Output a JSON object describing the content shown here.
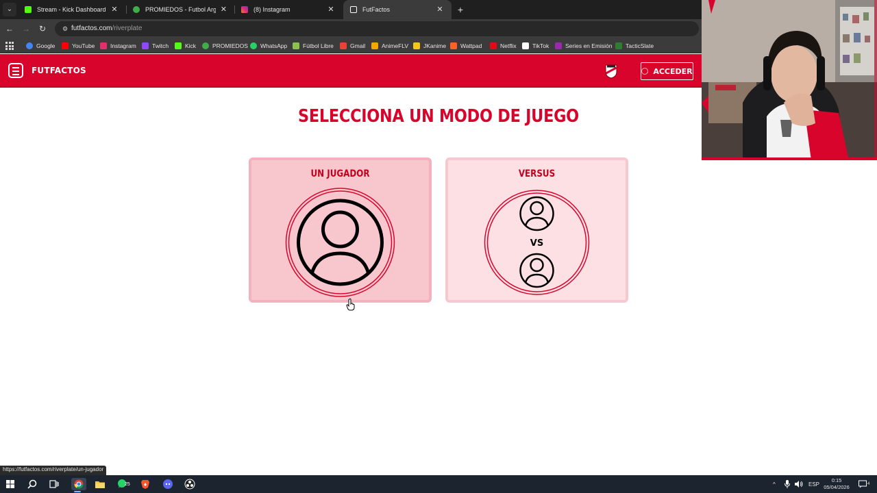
{
  "browser": {
    "tabs": [
      {
        "title": "Stream - Kick Dashboard",
        "icon": "kick-icon",
        "color": "#53fc18",
        "active": false
      },
      {
        "title": "PROMIEDOS - Futbol Argentino",
        "icon": "promiedos-icon",
        "color": "#3fae49",
        "active": false
      },
      {
        "title": "(8) Instagram",
        "icon": "instagram-icon",
        "color": "#e1306c",
        "active": false
      },
      {
        "title": "FutFactos",
        "icon": "futfactos-icon",
        "color": "#ffffff",
        "active": true
      }
    ],
    "close_glyph": "✕",
    "new_tab_glyph": "+",
    "url_host": "futfactos.com",
    "url_path": "/riverplate",
    "bookmarks": [
      {
        "label": "Google",
        "icon": "google-icon",
        "color": "#4285f4"
      },
      {
        "label": "YouTube",
        "icon": "youtube-icon",
        "color": "#ff0000"
      },
      {
        "label": "Instagram",
        "icon": "instagram-icon",
        "color": "#e1306c"
      },
      {
        "label": "Twitch",
        "icon": "twitch-icon",
        "color": "#9146ff"
      },
      {
        "label": "Kick",
        "icon": "kick-icon",
        "color": "#53fc18"
      },
      {
        "label": "PROMIEDOS",
        "icon": "promiedos-icon",
        "color": "#3fae49"
      },
      {
        "label": "WhatsApp",
        "icon": "whatsapp-icon",
        "color": "#25d366"
      },
      {
        "label": "Fútbol Libre",
        "icon": "futbol-libre-icon",
        "color": "#8bc34a"
      },
      {
        "label": "Gmail",
        "icon": "gmail-icon",
        "color": "#ea4335"
      },
      {
        "label": "AnimeFLV",
        "icon": "animeflv-icon",
        "color": "#f7a600"
      },
      {
        "label": "JKanime",
        "icon": "jkanime-icon",
        "color": "#f5c518"
      },
      {
        "label": "Wattpad",
        "icon": "wattpad-icon",
        "color": "#ff6122"
      },
      {
        "label": "Netflix",
        "icon": "netflix-icon",
        "color": "#e50914"
      },
      {
        "label": "TikTok",
        "icon": "tiktok-icon",
        "color": "#ffffff"
      },
      {
        "label": "Series en Emisión",
        "icon": "series-icon",
        "color": "#9c27b0"
      },
      {
        "label": "TacticSlate",
        "icon": "tacticslate-icon",
        "color": "#2e7d32"
      }
    ],
    "status_url": "https://futfactos.com/riverplate/un-jugador"
  },
  "site": {
    "brand": "FUTFACTOS",
    "login_label": "ACCEDER",
    "title": "SELECCIONA UN MODO DE JUEGO",
    "modes": [
      {
        "title": "UN JUGADOR"
      },
      {
        "title": "VERSUS",
        "vs_label": "VS"
      }
    ],
    "accent_color": "#d9042b"
  },
  "taskbar": {
    "apps": [
      "windows-start-icon",
      "search-icon",
      "task-view-icon",
      "chrome-icon",
      "file-explorer-icon",
      "whatsapp-icon",
      "brave-icon",
      "discord-icon",
      "obs-icon"
    ],
    "whatsapp_badge": "25",
    "language": "ESP",
    "time": "0:15",
    "date": "05/04/2026",
    "notifications": "4"
  }
}
